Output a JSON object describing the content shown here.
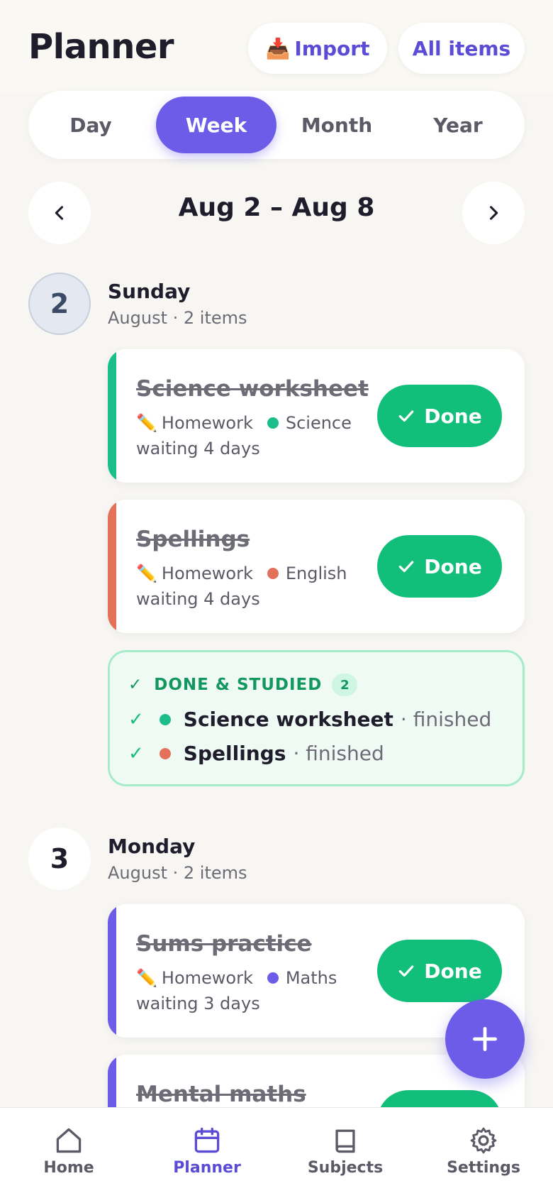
{
  "header": {
    "title": "Planner",
    "import_icon": "inbox-tray-emoji",
    "import_glyph": "📥",
    "import_label": "Import",
    "all_items_label": "All items"
  },
  "view_tabs": {
    "items": [
      {
        "label": "Day",
        "active": false
      },
      {
        "label": "Week",
        "active": true
      },
      {
        "label": "Month",
        "active": false
      },
      {
        "label": "Year",
        "active": false
      }
    ]
  },
  "range": {
    "title": "Aug 2 – Aug 8",
    "prev_icon": "chevron-left-icon",
    "next_icon": "chevron-right-icon"
  },
  "days": [
    {
      "number": "2",
      "name": "Sunday",
      "subtitle": "August · 2 items",
      "is_today": true,
      "tasks": [
        {
          "title": "Science worksheet",
          "type_glyph": "✏️",
          "type": "Homework",
          "subject": "Science",
          "subject_color": "#1bbd8b",
          "waiting": "waiting 4 days",
          "done_label": "Done"
        },
        {
          "title": "Spellings",
          "type_glyph": "✏️",
          "type": "Homework",
          "subject": "English",
          "subject_color": "#e4725a",
          "waiting": "waiting 4 days",
          "done_label": "Done"
        }
      ],
      "done_section": {
        "heading": "DONE & STUDIED",
        "count": "2",
        "items": [
          {
            "name": "Science worksheet",
            "status": "· finished",
            "color": "#1bbd8b"
          },
          {
            "name": "Spellings",
            "status": "· finished",
            "color": "#e4725a"
          }
        ]
      }
    },
    {
      "number": "3",
      "name": "Monday",
      "subtitle": "August · 2 items",
      "is_today": false,
      "tasks": [
        {
          "title": "Sums practice",
          "type_glyph": "✏️",
          "type": "Homework",
          "subject": "Maths",
          "subject_color": "#6c5ce7",
          "waiting": "waiting 3 days",
          "done_label": "Done"
        },
        {
          "title": "Mental maths",
          "subject_color": "#6c5ce7"
        }
      ]
    }
  ],
  "fab": {
    "icon": "plus-icon"
  },
  "bottom_nav": {
    "items": [
      {
        "label": "Home",
        "icon": "home-icon",
        "active": false
      },
      {
        "label": "Planner",
        "icon": "calendar-icon",
        "active": true
      },
      {
        "label": "Subjects",
        "icon": "book-icon",
        "active": false
      },
      {
        "label": "Settings",
        "icon": "gear-icon",
        "active": false
      }
    ]
  },
  "colors": {
    "accent": "#6c5ce7",
    "done_green": "#12bf7a",
    "background": "#f7f6f3"
  }
}
